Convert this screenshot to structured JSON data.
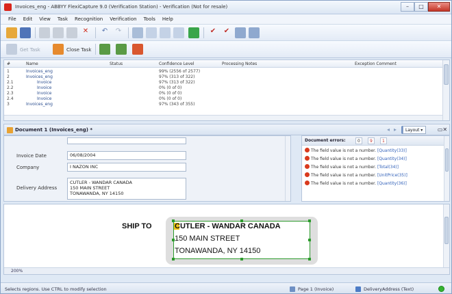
{
  "window": {
    "title": "Invoices_eng - ABBYY FlexiCapture 9.0 (Verification Station) - Verification (Not for resale)",
    "controls": {
      "minimize": "–",
      "maximize": "□",
      "close": "✕"
    }
  },
  "menu": [
    "File",
    "Edit",
    "View",
    "Task",
    "Recognition",
    "Verification",
    "Tools",
    "Help"
  ],
  "toolbar2": {
    "get_task": "Get Task",
    "close_task": "Close Task"
  },
  "task_grid": {
    "columns": [
      "#",
      "Name",
      "Status",
      "Confidence Level",
      "Processing Notes",
      "Exception Comment"
    ],
    "rows": [
      {
        "num": "1",
        "name": "Invoices_eng",
        "status": "",
        "confidence": "99% (2556 of 2577)"
      },
      {
        "num": "2",
        "name": "Invoices_eng",
        "status": "",
        "confidence": "97% (313 of 322)"
      },
      {
        "num": "2.1",
        "name": "Invoice",
        "status": "",
        "confidence": "97% (313 of 322)"
      },
      {
        "num": "2.2",
        "name": "Invoice",
        "status": "",
        "confidence": "0% (0 of 0)"
      },
      {
        "num": "2.3",
        "name": "Invoice",
        "status": "",
        "confidence": "0% (0 of 0)"
      },
      {
        "num": "2.4",
        "name": "Invoice",
        "status": "",
        "confidence": "0% (0 of 0)"
      },
      {
        "num": "3",
        "name": "Invoices_eng",
        "status": "",
        "confidence": "97% (343 of 355)"
      }
    ]
  },
  "document_panel": {
    "title": "Document 1 (Invoices_eng) *",
    "layout_label": "Layout ▾"
  },
  "form": {
    "invoice_date_label": "Invoice Date",
    "invoice_date_value": "06/08/2004",
    "company_label": "Company",
    "company_value": "I NAZON INC",
    "delivery_label": "Delivery Address",
    "delivery_lines": [
      "CUTLER - WANDAR CANADA",
      "150 MAIN STREET",
      "TONAWANDA, NY 14150"
    ]
  },
  "errors": {
    "header": "Document errors:",
    "counts": [
      "0",
      "9",
      "1"
    ],
    "items": [
      {
        "text": "The field value is not a number.",
        "field": "[Quantity(33)]"
      },
      {
        "text": "The field value is not a number.",
        "field": "[Quantity(34)]"
      },
      {
        "text": "The field value is not a number.",
        "field": "[Total(34)]"
      },
      {
        "text": "The field value is not a number.",
        "field": "[UnitPrice(35)]"
      },
      {
        "text": "The field value is not a number.",
        "field": "[Quantity(36)]"
      }
    ]
  },
  "image_view": {
    "ship_to": "SHIP TO",
    "address_lines": [
      "CUTLER - WANDAR CANADA",
      "150 MAIN STREET",
      "TONAWANDA, NY 14150"
    ],
    "zoom": "200%"
  },
  "status": {
    "hint": "Selects regions. Use CTRL to modify selection",
    "page": "Page 1 (Invoice)",
    "field": "DeliveryAddress (Text)"
  },
  "colors": {
    "accent": "#2f5fb8",
    "error": "#d93a1e",
    "ok": "#35b330",
    "selection": "#2c9a2c"
  }
}
